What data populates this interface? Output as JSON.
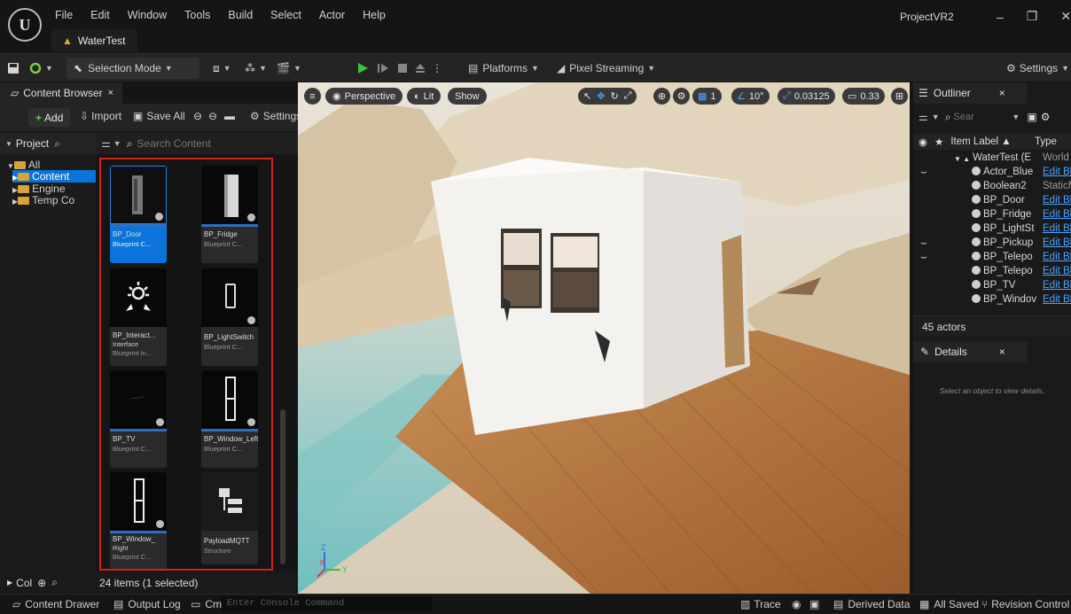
{
  "menu": [
    "File",
    "Edit",
    "Window",
    "Tools",
    "Build",
    "Select",
    "Actor",
    "Help"
  ],
  "level_tab": "WaterTest",
  "project_name": "ProjectVR2",
  "toolbar": {
    "selection_mode": "Selection Mode",
    "platforms": "Platforms",
    "pixel_streaming": "Pixel Streaming",
    "settings": "Settings"
  },
  "content_browser": {
    "tab_label": "Content Browser",
    "tab_close": "×",
    "add": "Add",
    "import": "Import",
    "save_all": "Save All",
    "settings": "Settings",
    "sources_header": "Project",
    "search_placeholder": "Search Content",
    "tree": {
      "all": "All",
      "content": "Content",
      "engine": "Engine",
      "temp": "Temp Co"
    },
    "collections": "Col",
    "item_count": "24 items (1 selected)",
    "assets": [
      {
        "name": "BP_Door",
        "type": "Blueprint C...",
        "selected": true,
        "icon": "door-icon"
      },
      {
        "name": "BP_Fridge",
        "type": "Blueprint C...",
        "selected": false,
        "icon": "fridge-icon"
      },
      {
        "name": "BP_Interact...",
        "subtitle": "Interface",
        "type": "Blueprint In...",
        "selected": false,
        "icon": "interact-icon"
      },
      {
        "name": "BP_LightSwitch",
        "type": "Blueprint C...",
        "selected": false,
        "icon": "lightswitch-icon"
      },
      {
        "name": "BP_TV",
        "type": "Blueprint C...",
        "selected": false,
        "icon": "tv-icon"
      },
      {
        "name": "BP_Window_Left",
        "type": "Blueprint C...",
        "selected": false,
        "icon": "window-icon"
      },
      {
        "name": "BP_Window_",
        "subtitle": "Right",
        "type": "Blueprint C...",
        "selected": false,
        "icon": "window-icon"
      },
      {
        "name": "PayloadMQTT",
        "type": "Structure",
        "selected": false,
        "icon": "structure-icon"
      }
    ]
  },
  "viewport": {
    "perspective": "Perspective",
    "lit": "Lit",
    "show": "Show",
    "grid_size": "1",
    "rotation_snap": "10°",
    "scale_snap": "0.03125",
    "camera_speed": "0.33"
  },
  "outliner": {
    "tab_label": "Outliner",
    "tab_close": "×",
    "search_placeholder": "Sear",
    "col_label": "Item Label ▲",
    "col_type": "Type",
    "rows": [
      {
        "name": "WaterTest (E",
        "type": "World",
        "link": false
      },
      {
        "name": "Actor_Blue",
        "type": "Edit Bl",
        "link": true
      },
      {
        "name": "Boolean2",
        "type": "StaticM",
        "link": false
      },
      {
        "name": "BP_Door",
        "type": "Edit Bl",
        "link": true
      },
      {
        "name": "BP_Fridge",
        "type": "Edit Bl",
        "link": true
      },
      {
        "name": "BP_LightSt",
        "type": "Edit Bl",
        "link": true
      },
      {
        "name": "BP_Pickup",
        "type": "Edit Bl",
        "link": true
      },
      {
        "name": "BP_Telepo",
        "type": "Edit Bl",
        "link": true
      },
      {
        "name": "BP_Telepo",
        "type": "Edit Bl",
        "link": true
      },
      {
        "name": "BP_TV",
        "type": "Edit Bl",
        "link": true
      },
      {
        "name": "BP_Windov",
        "type": "Edit Bl",
        "link": true
      }
    ],
    "actor_count": "45 actors"
  },
  "details": {
    "tab_label": "Details",
    "tab_close": "×",
    "empty_text": "Select an object to view details."
  },
  "status": {
    "content_drawer": "Content Drawer",
    "output_log": "Output Log",
    "cmd": "Cmd",
    "console_placeholder": "Enter Console Command",
    "trace": "Trace",
    "derived_data": "Derived Data",
    "all_saved": "All Saved",
    "revision_control": "Revision Control"
  },
  "colors": {
    "accent": "#0a74da",
    "highlight_box": "#d41f1f",
    "play": "#3cc23c",
    "link": "#4aa3ff"
  }
}
